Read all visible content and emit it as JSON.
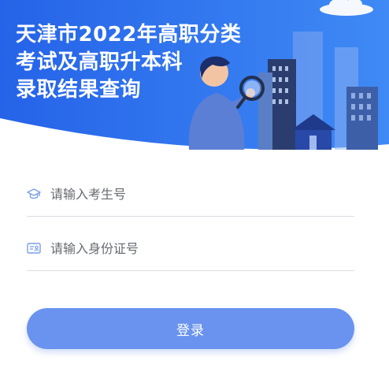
{
  "header": {
    "title_lines": [
      "天津市2022年高职分类",
      "考试及高职升本科",
      "录取结果查询"
    ]
  },
  "form": {
    "exam_number": {
      "icon": "graduation-cap-icon",
      "placeholder": "请输入考生号",
      "value": ""
    },
    "id_number": {
      "icon": "id-card-icon",
      "placeholder": "请输入身份证号",
      "value": ""
    },
    "login_label": "登录"
  },
  "colors": {
    "banner_left": "#2563e8",
    "banner_right": "#3f8af5",
    "button": "#6a93ef",
    "icon": "#7a9ee8"
  }
}
